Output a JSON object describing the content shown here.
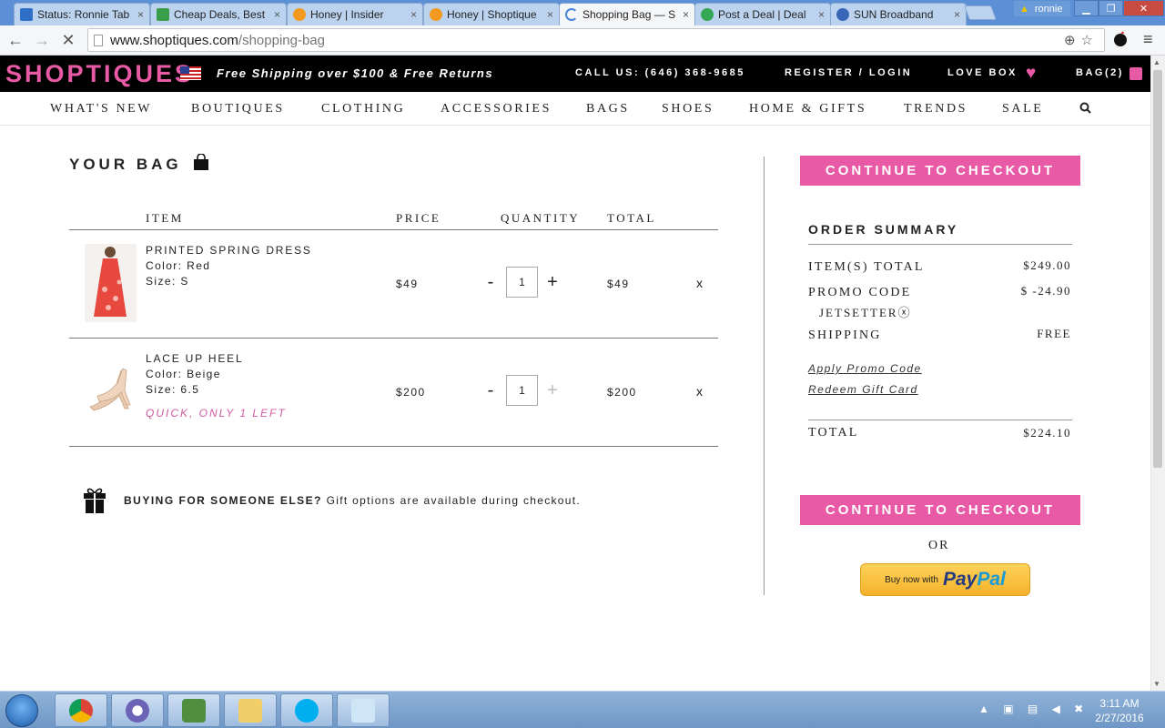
{
  "browser": {
    "tabs": [
      {
        "title": "Status: Ronnie Tab",
        "favicon_color": "#2f6fc7",
        "active": false
      },
      {
        "title": "Cheap Deals, Best",
        "favicon_color": "#3a9d4c",
        "active": false
      },
      {
        "title": "Honey | Insider",
        "favicon_color": "#f29a1f",
        "active": false
      },
      {
        "title": "Honey | Shoptique",
        "favicon_color": "#f29a1f",
        "active": false
      },
      {
        "title": "Shopping Bag — S",
        "favicon_color": "#4a86d8",
        "active": true
      },
      {
        "title": "Post a Deal | Deal",
        "favicon_color": "#34a853",
        "active": false
      },
      {
        "title": "SUN Broadband",
        "favicon_color": "#3a66b8",
        "active": false
      }
    ],
    "tab_close_glyph": "×",
    "profile_name": "ronnie",
    "url_host": "www.shoptiques.com",
    "url_path": "/shopping-bag",
    "window_controls": {
      "minimize": "▁",
      "maximize": "❐",
      "close": "✕"
    }
  },
  "site": {
    "logo": "SHOPTIQUES",
    "promo_banner": "Free Shipping over $100 & Free Returns",
    "call_us": "CALL US: (646) 368-9685",
    "register_login": "REGISTER / LOGIN",
    "love_box": "LOVE BOX",
    "bag_count": "BAG(2)",
    "brand_color": "#e95aa6",
    "categories": [
      "WHAT'S NEW",
      "BOUTIQUES",
      "CLOTHING",
      "ACCESSORIES",
      "BAGS",
      "SHOES",
      "HOME & GIFTS",
      "TRENDS",
      "SALE"
    ]
  },
  "bag": {
    "title": "YOUR BAG",
    "columns": {
      "item": "ITEM",
      "price": "PRICE",
      "quantity": "QUANTITY",
      "total": "TOTAL"
    },
    "items": [
      {
        "name": "PRINTED SPRING DRESS",
        "color": "Color: Red",
        "size": "Size: S",
        "price": "$49",
        "quantity": "1",
        "total": "$49",
        "stock_note": "",
        "can_increase": true
      },
      {
        "name": "LACE UP HEEL",
        "color": "Color: Beige",
        "size": "Size: 6.5",
        "price": "$200",
        "quantity": "1",
        "total": "$200",
        "stock_note": "QUICK, ONLY 1 LEFT",
        "can_increase": false
      }
    ],
    "qty_minus": "-",
    "qty_plus": "+",
    "remove": "x",
    "gift_heading": "BUYING FOR SOMEONE ELSE?",
    "gift_text": "Gift options are available during checkout."
  },
  "summary": {
    "checkout_label": "CONTINUE TO CHECKOUT",
    "title": "ORDER SUMMARY",
    "items_total_label": "ITEM(S) TOTAL",
    "items_total_value": "$249.00",
    "promo_label": "PROMO CODE",
    "promo_value": "$ -24.90",
    "promo_code": "JETSETTER",
    "promo_remove_glyph": "ⓧ",
    "shipping_label": "SHIPPING",
    "shipping_value": "FREE",
    "apply_promo_link": "Apply Promo Code",
    "redeem_gift_link": "Redeem Gift Card",
    "total_label": "TOTAL",
    "total_value": "$224.10",
    "or_text": "OR",
    "paypal_buy": "Buy now with",
    "paypal_pay": "Pay",
    "paypal_pal": "Pal"
  },
  "taskbar": {
    "apps": [
      "chrome-icon",
      "media-icon",
      "tool-icon",
      "folder-icon",
      "skype-icon",
      "notepad-icon"
    ],
    "tray_arrow": "▲",
    "clock_time": "3:11 AM",
    "clock_date": "2/27/2016"
  }
}
